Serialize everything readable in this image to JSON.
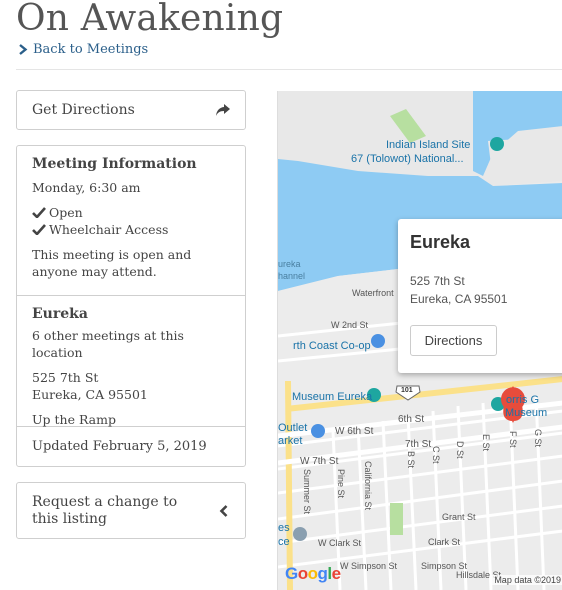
{
  "page": {
    "title": "On Awakening",
    "back_link": "Back to Meetings"
  },
  "directions_button": "Get Directions",
  "meeting_info": {
    "heading": "Meeting Information",
    "time": "Monday, 6:30 am",
    "types": [
      "Open",
      "Wheelchair Access"
    ],
    "description": "This meeting is open and anyone may attend."
  },
  "location": {
    "name": "Eureka",
    "other_meetings": "6 other meetings at this location",
    "address_line1": "525 7th St",
    "address_line2": "Eureka, CA 95501",
    "notes": "Up the Ramp"
  },
  "updated": "Updated February 5, 2019",
  "request_change": {
    "line1": "Request a change to",
    "line2": "this listing"
  },
  "map": {
    "popup_title": "Eureka",
    "popup_address1": "525 7th St",
    "popup_address2": "Eureka, CA 95501",
    "popup_button": "Directions",
    "labels": {
      "indian_island_1": "Indian Island Site",
      "indian_island_2": "67 (Tolowot) National...",
      "eureka_channel_1": "ureka",
      "eureka_channel_2": "hannel",
      "waterfront": "Waterfront",
      "w2nd": "W 2nd St",
      "coast_coop": "rth Coast Co-op",
      "museum_eureka": "Museum Eureka",
      "route": "101",
      "morris_1": "orris G",
      "morris_2": "Museum",
      "sixth": "6th St",
      "w6th": "W 6th St",
      "outlet_1": "Outlet",
      "outlet_2": "arket",
      "seventh": "7th St",
      "w7th": "W 7th St",
      "summer": "Summer St",
      "pine": "Pine St",
      "california": "California St",
      "b_st": "B St",
      "c_st": "C St",
      "d_st": "D St",
      "e_st": "E St",
      "f_st": "F St",
      "g_st": "G St",
      "grant": "Grant St",
      "wclark": "W Clark St",
      "clark": "Clark St",
      "es_1": "es",
      "es_2": "ce",
      "simpson_w": "W Simpson St",
      "simpson": "Simpson St",
      "hillsdale": "Hillsdale St",
      "google": "Google",
      "map_data": "Map data ©2019"
    }
  },
  "colors": {
    "link": "#2b5f8a",
    "water": "#8ecbf3",
    "road_major": "#fbe18a",
    "park": "#b7dfa0",
    "pin": "#e74c3c"
  }
}
